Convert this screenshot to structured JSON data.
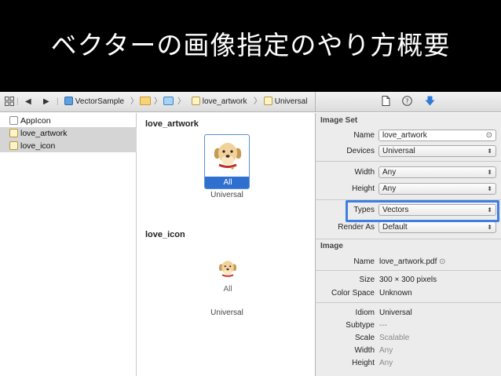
{
  "slide": {
    "title": "ベクターの画像指定のやり方概要"
  },
  "jumpbar": {
    "crumbs": [
      "VectorSample",
      "love_artwork",
      "Universal"
    ]
  },
  "sidebar": {
    "items": [
      {
        "label": "AppIcon"
      },
      {
        "label": "love_artwork"
      },
      {
        "label": "love_icon"
      }
    ]
  },
  "canvas": {
    "sets": [
      {
        "title": "love_artwork",
        "badge": "All",
        "slot": "Universal"
      },
      {
        "title": "love_icon",
        "badge": "All",
        "slot": "Universal"
      }
    ]
  },
  "inspector": {
    "image_set": {
      "section": "Image Set",
      "name_label": "Name",
      "name_value": "love_artwork",
      "devices_label": "Devices",
      "devices_value": "Universal",
      "width_label": "Width",
      "width_value": "Any",
      "height_label": "Height",
      "height_value": "Any",
      "types_label": "Types",
      "types_value": "Vectors",
      "render_label": "Render As",
      "render_value": "Default"
    },
    "image": {
      "section": "Image",
      "name_label": "Name",
      "name_value": "love_artwork.pdf",
      "size_label": "Size",
      "size_value": "300 × 300 pixels",
      "colorspace_label": "Color Space",
      "colorspace_value": "Unknown",
      "idiom_label": "Idiom",
      "idiom_value": "Universal",
      "subtype_label": "Subtype",
      "subtype_value": "---",
      "scale_label": "Scale",
      "scale_value": "Scalable",
      "width_label": "Width",
      "width_value": "Any",
      "height_label": "Height",
      "height_value": "Any"
    }
  },
  "colors": {
    "selection_blue": "#2f6fd0",
    "highlight_blue": "#3e7fe0"
  }
}
